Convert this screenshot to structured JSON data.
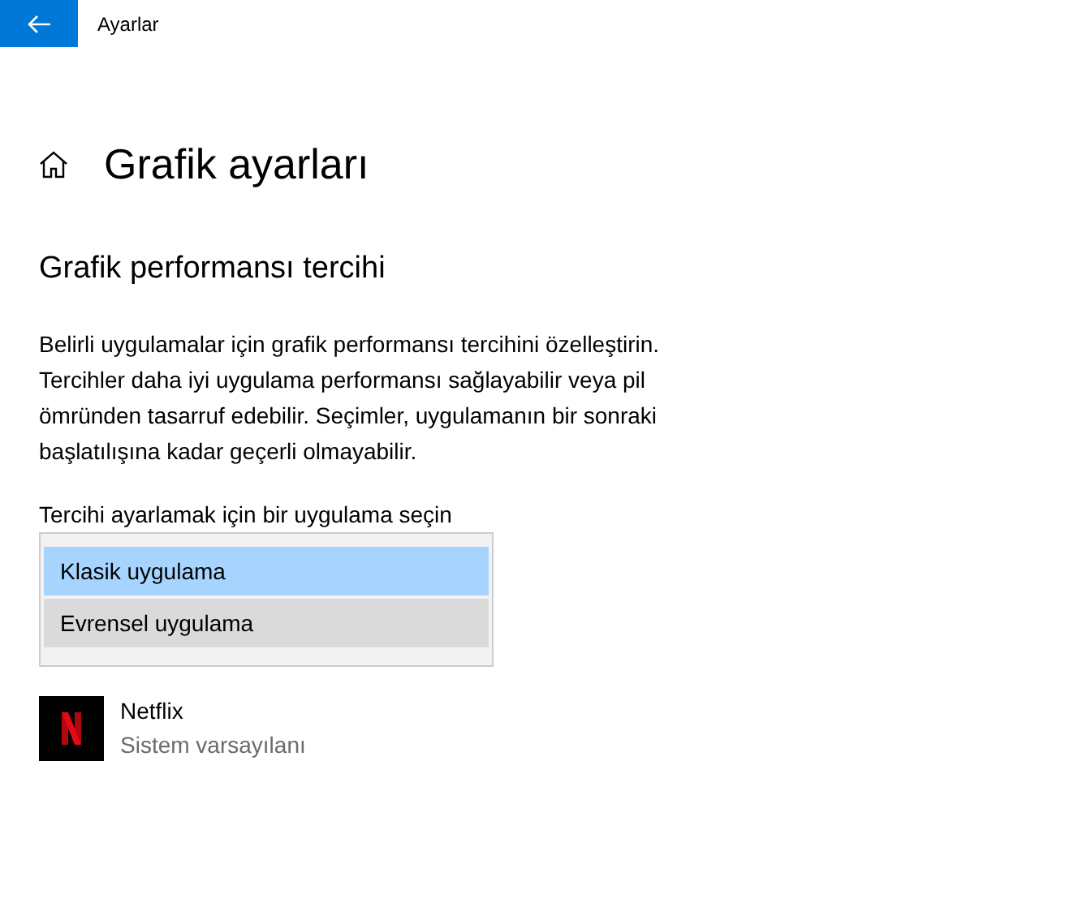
{
  "window": {
    "title": "Ayarlar"
  },
  "page": {
    "title": "Grafik ayarları"
  },
  "section": {
    "heading": "Grafik performansı tercihi",
    "description_lines": [
      "Belirli uygulamalar için grafik performansı tercihini özelleştirin.",
      "Tercihler daha iyi uygulama performansı sağlayabilir veya pil",
      "ömründen tasarruf edebilir. Seçimler, uygulamanın bir sonraki",
      "başlatılışına kadar geçerli olmayabilir."
    ]
  },
  "app_picker": {
    "label": "Tercihi ayarlamak için bir uygulama seçin",
    "expanded": true,
    "options": [
      {
        "label": "Klasik uygulama",
        "selected": true,
        "hovered": false
      },
      {
        "label": "Evrensel uygulama",
        "selected": false,
        "hovered": true
      }
    ]
  },
  "apps": [
    {
      "name": "Netflix",
      "preference": "Sistem varsayılanı"
    }
  ]
}
